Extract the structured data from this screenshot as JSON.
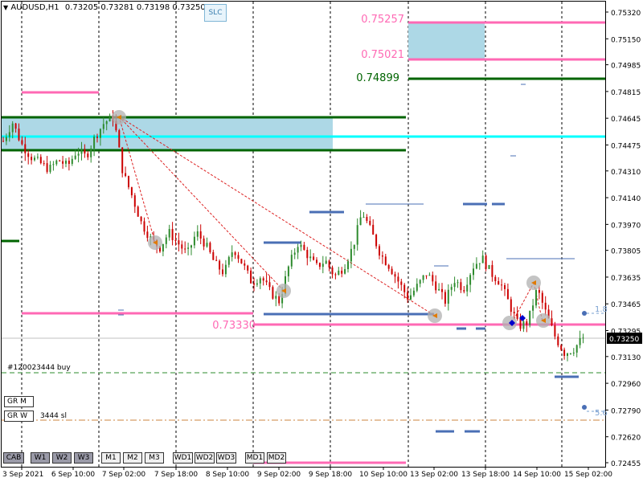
{
  "header": {
    "symbol": "AUDUSD,H1",
    "ohlc": "0.73205 0.73281 0.73198 0.73250",
    "dropdown_icon": "triangle-down-icon"
  },
  "slc_button": "SLC",
  "order_line_label": "#120023444 buy",
  "sl_line_label": "3444 sl",
  "price_labels": {
    "top_box_high": "0.75257",
    "top_box_low": "0.75021",
    "green_line": "0.74899",
    "pink_line": "0.73330"
  },
  "right_side_labels": {
    "ratio_a": "1.8",
    "ratio_b": "5.6"
  },
  "current_price": "0.73250",
  "buttons": {
    "gr_m": "GR M",
    "gr_w": "GR W",
    "cab": "CAB",
    "w1": "W1",
    "w2": "W2",
    "w3": "W3",
    "m1": "M1",
    "m2": "M2",
    "m3": "M3",
    "wd1": "WD1",
    "wd2": "WD2",
    "wd3": "WD3",
    "md1": "MD1",
    "md2": "MD2"
  },
  "colors": {
    "pink": "#ff69b4",
    "green": "#006400",
    "cyan": "#00ffff",
    "box": "#add8e6",
    "bull": "#2e8b2e",
    "bear": "#cc0000",
    "blue_seg": "#4a6fb5"
  },
  "chart_data": {
    "type": "candlestick",
    "symbol": "AUDUSD",
    "timeframe": "H1",
    "ylim": [
      0.724,
      0.754
    ],
    "y_ticks": [
      "0.75320",
      "0.75150",
      "0.74985",
      "0.74815",
      "0.74645",
      "0.74475",
      "0.74310",
      "0.74140",
      "0.73970",
      "0.73805",
      "0.73635",
      "0.73465",
      "0.73295",
      "0.73130",
      "0.72960",
      "0.72790",
      "0.72620",
      "0.72455"
    ],
    "x_ticks": [
      "3 Sep 2021",
      "6 Sep 10:00",
      "7 Sep 02:00",
      "7 Sep 18:00",
      "8 Sep 10:00",
      "9 Sep 02:00",
      "9 Sep 18:00",
      "10 Sep 10:00",
      "13 Sep 02:00",
      "13 Sep 18:00",
      "14 Sep 10:00",
      "15 Sep 02:00"
    ],
    "price_path": [
      0.745,
      0.7462,
      0.7448,
      0.744,
      0.7436,
      0.7432,
      0.7438,
      0.7434,
      0.7444,
      0.744,
      0.7453,
      0.7462,
      0.7465,
      0.743,
      0.7415,
      0.7398,
      0.7388,
      0.7382,
      0.7392,
      0.7385,
      0.7378,
      0.7392,
      0.7384,
      0.7372,
      0.7366,
      0.7382,
      0.7372,
      0.736,
      0.7364,
      0.7354,
      0.7348,
      0.737,
      0.7385,
      0.7378,
      0.737,
      0.7374,
      0.7364,
      0.737,
      0.7383,
      0.7405,
      0.7392,
      0.7378,
      0.737,
      0.736,
      0.735,
      0.7358,
      0.7366,
      0.7358,
      0.7348,
      0.7362,
      0.7356,
      0.737,
      0.7376,
      0.7366,
      0.736,
      0.7346,
      0.7332,
      0.7335,
      0.7356,
      0.734,
      0.7325,
      0.7315,
      0.7318,
      0.7325
    ],
    "current_price": 0.7325
  }
}
